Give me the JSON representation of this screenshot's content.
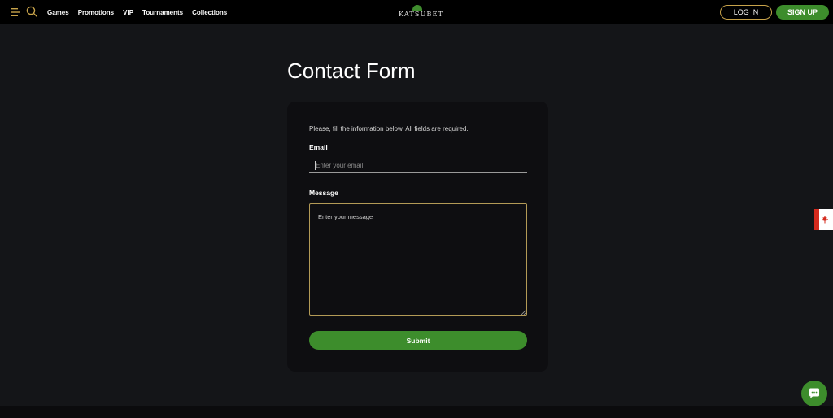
{
  "header": {
    "nav": [
      "Games",
      "Promotions",
      "VIP",
      "Tournaments",
      "Collections"
    ],
    "logo_text": "KATSUBET",
    "login_label": "LOG IN",
    "signup_label": "SIGN UP"
  },
  "page": {
    "title": "Contact Form"
  },
  "form": {
    "intro": "Please, fill the information below. All fields are required.",
    "email_label": "Email",
    "email_placeholder": "Enter your email",
    "email_value": "",
    "message_label": "Message",
    "message_placeholder": "Enter your message",
    "message_value": "",
    "submit_label": "Submit"
  },
  "icons": {
    "menu": "menu-icon",
    "search": "search-icon",
    "flag": "canada-flag-icon",
    "chat": "chat-icon"
  },
  "colors": {
    "accent_green": "#3d8d2c",
    "accent_gold": "#c8a34a",
    "background": "#141518",
    "card": "#0e0e11"
  }
}
